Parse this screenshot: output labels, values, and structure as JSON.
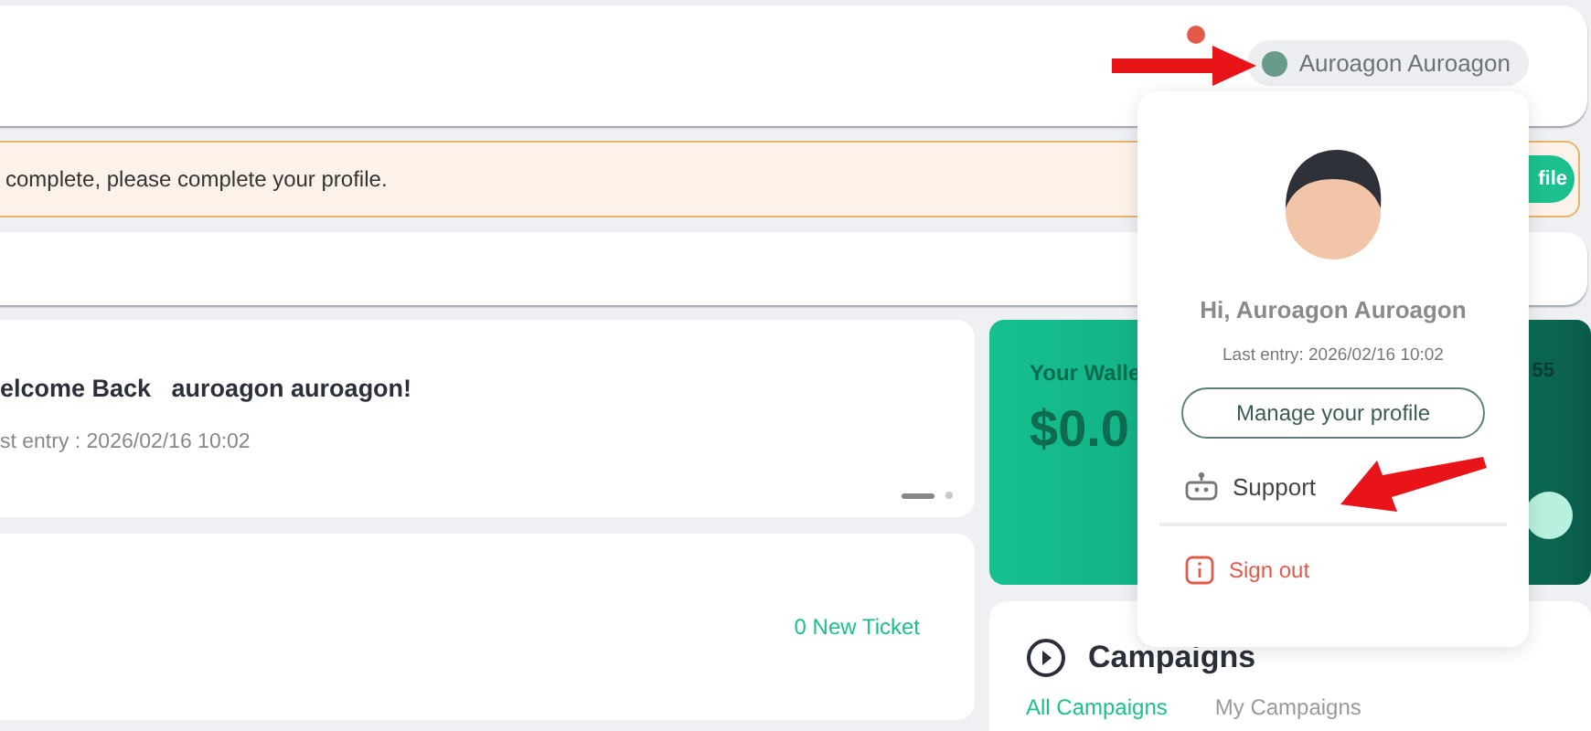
{
  "header": {
    "user_name": "Auroagon Auroagon"
  },
  "alert": {
    "message": "complete, please complete your profile.",
    "button": "file"
  },
  "welcome": {
    "title": "elcome Back   auroagon auroagon!",
    "subtitle": "st entry : 2026/02/16 10:02",
    "slides": [
      {
        "selected": true
      },
      {
        "selected": false
      }
    ]
  },
  "tickets": {
    "link": "0 New Ticket"
  },
  "wallet": {
    "title": "Your Walle",
    "amount": "$0.0",
    "column_2": "55"
  },
  "campaigns": {
    "title": "Campaigns",
    "tabs": [
      {
        "label": "All Campaigns",
        "selected": true
      },
      {
        "label": "My Campaigns",
        "selected": false
      }
    ]
  },
  "dropdown": {
    "greeting": "Hi, Auroagon Auroagon",
    "last_entry": "Last entry: 2026/02/16 10:02",
    "manage_button": "Manage your profile",
    "items": [
      {
        "label": "Support",
        "kind": "support"
      },
      {
        "label": "Sign out",
        "kind": "signout"
      }
    ]
  }
}
